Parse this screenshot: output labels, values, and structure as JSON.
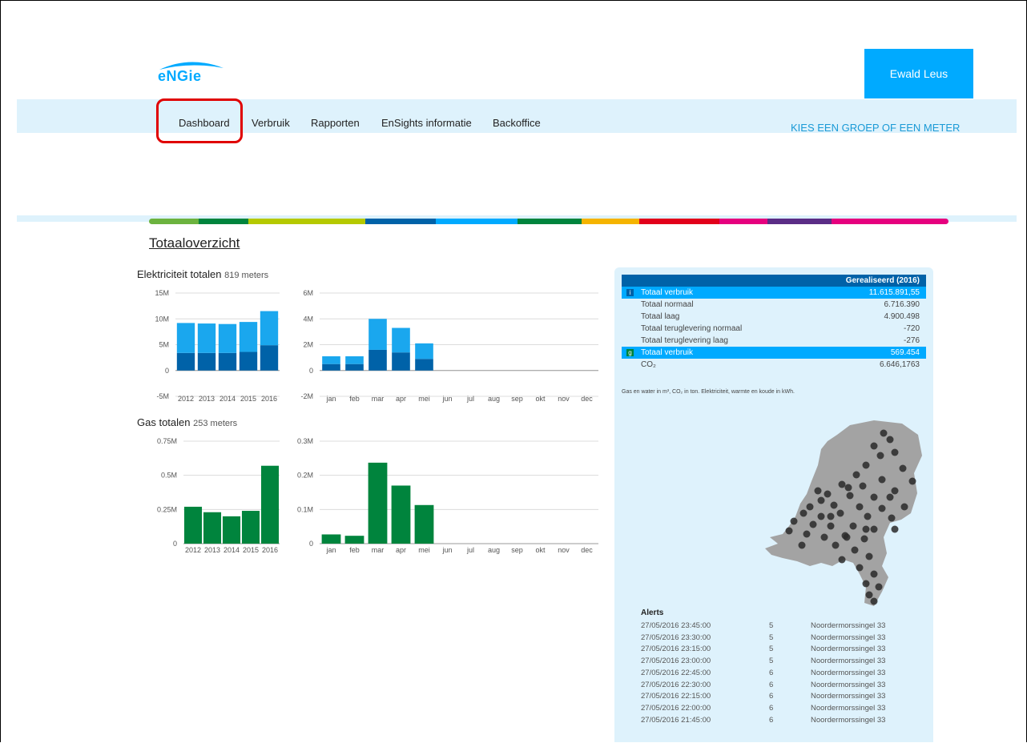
{
  "header": {
    "logo_text": "eNGie",
    "user_name": "Ewald Leus"
  },
  "nav": {
    "items": [
      "Dashboard",
      "Verbruik",
      "Rapporten",
      "EnSights informatie",
      "Backoffice"
    ],
    "selector_link": "KIES EEN GROEP OF EEN METER"
  },
  "page": {
    "title": "Totaaloverzicht"
  },
  "colors": {
    "brand_blue": "#00aaff",
    "dark_blue": "#0062a8",
    "gas_green": "#00843d",
    "nav_bg": "#def2fc",
    "highlight_red": "#e00000"
  },
  "sections": {
    "elec": {
      "title": "Elektriciteit totalen",
      "count": "819 meters"
    },
    "gas": {
      "title": "Gas totalen",
      "count": "253 meters"
    }
  },
  "chart_data": [
    {
      "type": "bar",
      "stacked": true,
      "categories": [
        "2012",
        "2013",
        "2014",
        "2015",
        "2016"
      ],
      "series": [
        {
          "values": [
            3.4,
            3.4,
            3.4,
            3.6,
            4.9
          ]
        },
        {
          "values": [
            5.8,
            5.7,
            5.6,
            5.8,
            6.6
          ]
        }
      ],
      "ylim": [
        -5,
        15
      ],
      "yticks": [
        "15M",
        "10M",
        "5M",
        "0",
        "-5M"
      ]
    },
    {
      "type": "bar",
      "stacked": true,
      "categories": [
        "jan",
        "feb",
        "mar",
        "apr",
        "mei",
        "jun",
        "jul",
        "aug",
        "sep",
        "okt",
        "nov",
        "dec"
      ],
      "series": [
        {
          "values": [
            0.5,
            0.5,
            1.6,
            1.4,
            0.9,
            0,
            0,
            0,
            0,
            0,
            0,
            0
          ]
        },
        {
          "values": [
            0.6,
            0.6,
            2.4,
            1.9,
            1.2,
            0,
            0,
            0,
            0,
            0,
            0,
            0
          ]
        }
      ],
      "ylim": [
        -2,
        6
      ],
      "yticks": [
        "6M",
        "4M",
        "2M",
        "0",
        "-2M"
      ]
    },
    {
      "type": "bar",
      "categories": [
        "2012",
        "2013",
        "2014",
        "2015",
        "2016"
      ],
      "values": [
        0.27,
        0.23,
        0.2,
        0.24,
        0.57
      ],
      "ylim": [
        0,
        0.75
      ],
      "yticks": [
        "0.75M",
        "0.5M",
        "0.25M",
        "0"
      ]
    },
    {
      "type": "bar",
      "categories": [
        "jan",
        "feb",
        "mar",
        "apr",
        "mei",
        "jun",
        "jul",
        "aug",
        "sep",
        "okt",
        "nov",
        "dec"
      ],
      "values": [
        0.027,
        0.023,
        0.237,
        0.17,
        0.113,
        0,
        0,
        0,
        0,
        0,
        0,
        0
      ],
      "ylim": [
        0,
        0.3
      ],
      "yticks": [
        "0.3M",
        "0.2M",
        "0.1M",
        "0"
      ]
    }
  ],
  "summary": {
    "header": "Gerealiseerd (2016)",
    "rows": [
      {
        "label": "Totaal verbruik",
        "value": "11.615.891,55"
      },
      {
        "label": "Totaal normaal",
        "value": "6.716.390"
      },
      {
        "label": "Totaal laag",
        "value": "4.900.498"
      },
      {
        "label": "Totaal teruglevering normaal",
        "value": "-720"
      },
      {
        "label": "Totaal teruglevering laag",
        "value": "-276"
      },
      {
        "label": "Totaal verbruik",
        "value": "569.454"
      },
      {
        "label": "CO₂",
        "value": "6.646,1763"
      }
    ],
    "note": "Gas en water in m³, CO₂  in ton. Elektriciteit, warmte en koude in kWh."
  },
  "alerts": {
    "title": "Alerts",
    "rows": [
      {
        "time": "27/05/2016 23:45:00",
        "level": "5",
        "location": "Noordermorssingel 33"
      },
      {
        "time": "27/05/2016 23:30:00",
        "level": "5",
        "location": "Noordermorssingel 33"
      },
      {
        "time": "27/05/2016 23:15:00",
        "level": "5",
        "location": "Noordermorssingel 33"
      },
      {
        "time": "27/05/2016 23:00:00",
        "level": "5",
        "location": "Noordermorssingel 33"
      },
      {
        "time": "27/05/2016 22:45:00",
        "level": "6",
        "location": "Noordermorssingel 33"
      },
      {
        "time": "27/05/2016 22:30:00",
        "level": "6",
        "location": "Noordermorssingel 33"
      },
      {
        "time": "27/05/2016 22:15:00",
        "level": "6",
        "location": "Noordermorssingel 33"
      },
      {
        "time": "27/05/2016 22:00:00",
        "level": "6",
        "location": "Noordermorssingel 33"
      },
      {
        "time": "27/05/2016 21:45:00",
        "level": "6",
        "location": "Noordermorssingel 33"
      }
    ]
  }
}
